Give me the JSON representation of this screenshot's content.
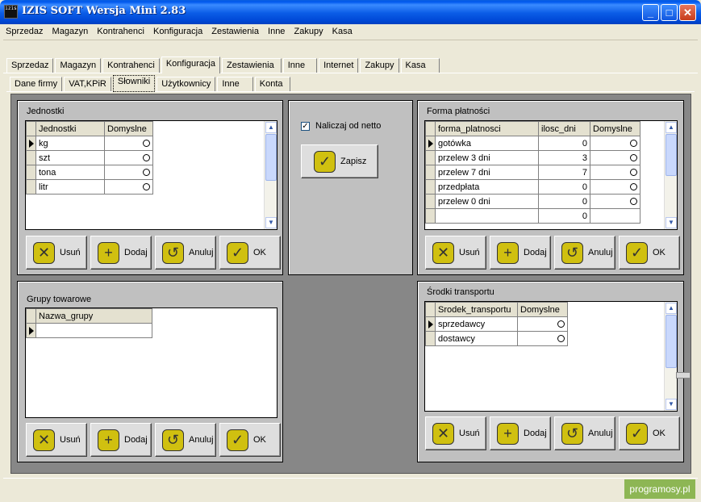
{
  "window": {
    "title": "IZIS SOFT Wersja Mini 2.83",
    "icon_text": "izis"
  },
  "window_buttons": {
    "minimize": "_",
    "maximize": "□",
    "close": "✕"
  },
  "menu": [
    "Sprzedaz",
    "Magazyn",
    "Kontrahenci",
    "Konfiguracja",
    "Zestawienia",
    "Inne",
    "Zakupy",
    "Kasa"
  ],
  "main_tabs": [
    "Sprzedaz",
    "Magazyn",
    "Kontrahenci",
    "Konfiguracja",
    "Zestawienia",
    "Inne",
    "Internet",
    "Zakupy",
    "Kasa"
  ],
  "main_tab_active": "Konfiguracja",
  "sub_tabs": [
    "Dane firmy",
    "VAT,KPiR",
    "Słowniki",
    "Użytkownicy",
    "Inne",
    "Konta"
  ],
  "sub_tab_active": "Słowniki",
  "jednostki": {
    "title": "Jednostki",
    "columns": [
      "Jednostki",
      "Domyslne"
    ],
    "rows": [
      "kg",
      "szt",
      "tona",
      "litr"
    ]
  },
  "netto": {
    "checkbox_label": "Naliczaj od netto",
    "checked": true,
    "save_label": "Zapisz"
  },
  "forma_platnosci": {
    "title": "Forma płatności",
    "columns": [
      "forma_platnosci",
      "ilosc_dni",
      "Domyslne"
    ],
    "rows": [
      {
        "name": "gotówka",
        "days": "0"
      },
      {
        "name": "przelew 3 dni",
        "days": "3"
      },
      {
        "name": "przelew 7 dni",
        "days": "7"
      },
      {
        "name": "przedpłata",
        "days": "0"
      },
      {
        "name": "przelew 0 dni",
        "days": "0"
      },
      {
        "name": "",
        "days": "0"
      }
    ]
  },
  "grupy": {
    "title": "Grupy towarowe",
    "columns": [
      "Nazwa_grupy"
    ]
  },
  "transport": {
    "title": "Środki transportu",
    "columns": [
      "Srodek_transportu",
      "Domyslne"
    ],
    "rows": [
      "sprzedawcy",
      "dostawcy"
    ]
  },
  "buttons": {
    "delete": "Usuń",
    "add": "Dodaj",
    "cancel": "Anuluj",
    "ok": "OK"
  },
  "watermark": "programosy.pl",
  "colors": {
    "titlebar": "#0058ee",
    "workspace": "#878787",
    "panel": "#c0c0c0",
    "button_icon": "#d0c010"
  }
}
